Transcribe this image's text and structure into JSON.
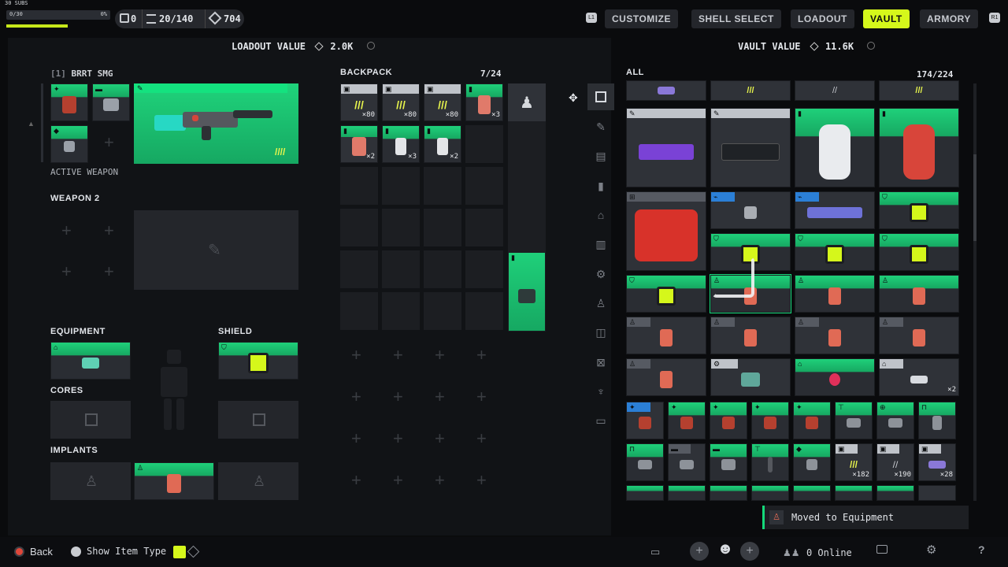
{
  "hud": {
    "subs": "30 SUBS",
    "progress_left": "0/30",
    "progress_right": "0%",
    "stat_keys": "0",
    "stat_storage": "20/140",
    "stat_currency": "704"
  },
  "tabs": [
    {
      "label": "CUSTOMIZE"
    },
    {
      "label": "SHELL SELECT"
    },
    {
      "label": "LOADOUT"
    },
    {
      "label": "VAULT"
    },
    {
      "label": "ARMORY"
    }
  ],
  "tab_hint_left": "L1",
  "tab_hint_right": "R1",
  "loadout": {
    "value_label": "LOADOUT VALUE",
    "value": "2.0K",
    "weapon_slot": "[1]",
    "weapon_name": "BRRT SMG",
    "active_weapon": "ACTIVE WEAPON",
    "weapon2": "WEAPON 2",
    "equipment": "EQUIPMENT",
    "shield": "SHIELD",
    "cores": "CORES",
    "implants": "IMPLANTS"
  },
  "backpack": {
    "title": "BACKPACK",
    "count": "7/24",
    "items": [
      {
        "qty": "×80"
      },
      {
        "qty": "×80"
      },
      {
        "qty": "×80"
      },
      {
        "qty": "×3"
      },
      {
        "qty": "×2"
      },
      {
        "qty": "×3"
      },
      {
        "qty": "×2"
      }
    ]
  },
  "vault": {
    "value_label": "VAULT VALUE",
    "value": "11.6K",
    "filter": "ALL",
    "count": "174/224",
    "small_qty": [
      "×182",
      "×190",
      "×28"
    ],
    "stack_qty": "×2"
  },
  "toast": {
    "text": "Moved to Equipment"
  },
  "footer": {
    "back": "Back",
    "show_item_type": "Show Item Type",
    "online": "0 Online"
  },
  "colors": {
    "accent": "#d5f71b",
    "rarity_green": "#14d97a",
    "rarity_blue": "#2b7fd6"
  }
}
